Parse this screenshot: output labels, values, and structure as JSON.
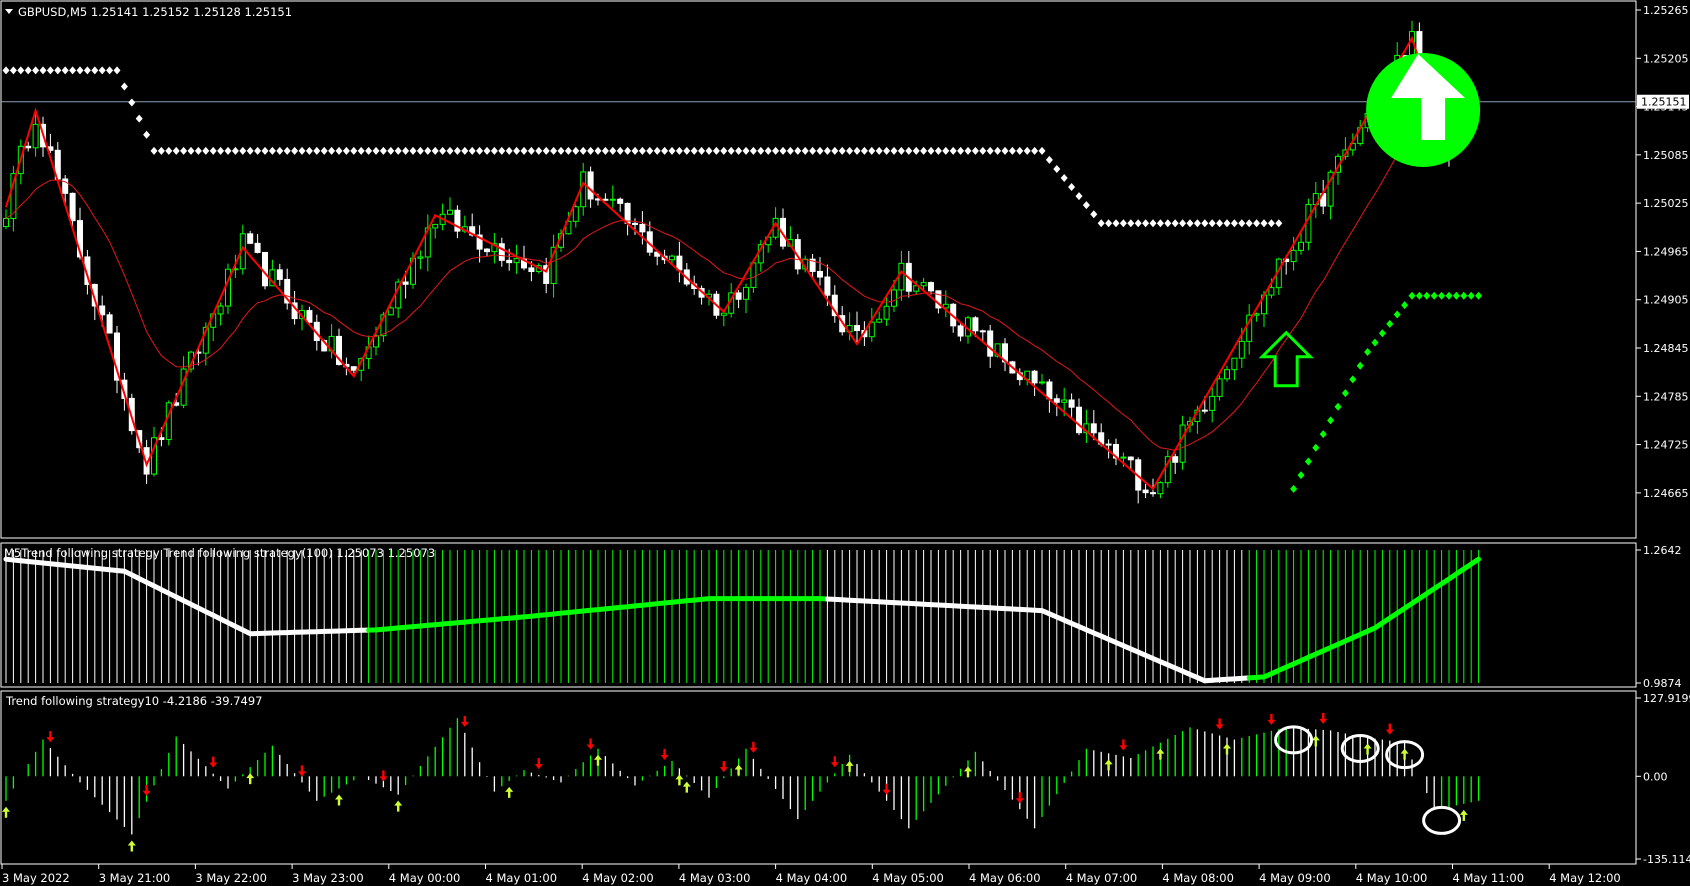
{
  "chart_data": [
    {
      "type": "line",
      "subtype": "candlestick",
      "title": "GBPUSD,M5  1.25141 1.25152 1.25128 1.25151",
      "symbol": "GBPUSD",
      "timeframe": "M5",
      "ohlc_header": {
        "open": 1.25141,
        "high": 1.25152,
        "low": 1.25128,
        "close": 1.25151
      },
      "ylim": [
        1.24635,
        1.25265
      ],
      "y_ticks": [
        "1.25265",
        "1.25205",
        "1.25145",
        "1.25085",
        "1.25025",
        "1.24965",
        "1.24905",
        "1.24845",
        "1.24785",
        "1.24725",
        "1.24665"
      ],
      "current_price_label": "1.25151",
      "current_price": 1.25151,
      "zigzag_pivots": [
        {
          "bar": 0,
          "price": 1.2502
        },
        {
          "bar": 4,
          "price": 1.2514
        },
        {
          "bar": 19,
          "price": 1.247
        },
        {
          "bar": 32,
          "price": 1.2497
        },
        {
          "bar": 47,
          "price": 1.2481
        },
        {
          "bar": 58,
          "price": 1.2501
        },
        {
          "bar": 73,
          "price": 1.2494
        },
        {
          "bar": 78,
          "price": 1.2505
        },
        {
          "bar": 97,
          "price": 1.2489
        },
        {
          "bar": 104,
          "price": 1.25
        },
        {
          "bar": 115,
          "price": 1.2485
        },
        {
          "bar": 121,
          "price": 1.2494
        },
        {
          "bar": 155,
          "price": 1.2467
        },
        {
          "bar": 190,
          "price": 1.2523
        },
        {
          "bar": 195,
          "price": 1.2509
        }
      ],
      "upper_dots": [
        {
          "bar": 0,
          "price": 1.2519
        },
        {
          "bar": 15,
          "price": 1.2519
        },
        {
          "bar": 20,
          "price": 1.2509
        },
        {
          "bar": 140,
          "price": 1.2509
        },
        {
          "bar": 148,
          "price": 1.25
        },
        {
          "bar": 172,
          "price": 1.25
        }
      ],
      "lower_dots": [
        {
          "bar": 174,
          "price": 1.2467
        },
        {
          "bar": 184,
          "price": 1.2484
        },
        {
          "bar": 190,
          "price": 1.2491
        },
        {
          "bar": 199,
          "price": 1.2491
        }
      ],
      "colors": {
        "up_candle": "#00ff00",
        "down_candle": "#ffffff",
        "zigzag": "#ff0000",
        "moving_average": "#e21818",
        "dots": "#ffffff",
        "lower_dots": "#00ff00",
        "signal_arrow": "#00ff00",
        "price_line": "#8a9fb5"
      }
    },
    {
      "type": "bar",
      "title": "M5Trend following strategy  Trend following strategy(100) 1.25073 1.25073",
      "ylim": [
        0.9874,
        1.2642
      ],
      "y_ticks": [
        "1.2642",
        "0.9874"
      ],
      "trend_line": [
        {
          "bar": 0,
          "value": 1.245
        },
        {
          "bar": 16,
          "value": 1.22
        },
        {
          "bar": 33,
          "value": 1.09
        },
        {
          "bar": 50,
          "value": 1.098
        },
        {
          "bar": 70,
          "value": 1.125
        },
        {
          "bar": 95,
          "value": 1.163
        },
        {
          "bar": 110,
          "value": 1.163
        },
        {
          "bar": 140,
          "value": 1.138
        },
        {
          "bar": 162,
          "value": 0.992
        },
        {
          "bar": 170,
          "value": 1.0
        },
        {
          "bar": 185,
          "value": 1.102
        },
        {
          "bar": 199,
          "value": 1.245
        }
      ],
      "green_segments": [
        [
          49,
          110
        ],
        [
          168,
          199
        ]
      ],
      "colors": {
        "bars_up": "#00ff00",
        "bars_down": "#ffffff",
        "line_up": "#00ff00",
        "line_down": "#ffffff"
      }
    },
    {
      "type": "bar",
      "title": "Trend following strategy10 -4.2186 -39.7497",
      "ylim": [
        -135.114,
        127.9199
      ],
      "y_ticks": [
        "127.9199",
        "0.00",
        "-135.114"
      ],
      "oscillator": [
        {
          "bar": 0,
          "value": -40
        },
        {
          "bar": 5,
          "value": 60
        },
        {
          "bar": 10,
          "value": -10
        },
        {
          "bar": 17,
          "value": -95
        },
        {
          "bar": 23,
          "value": 65
        },
        {
          "bar": 30,
          "value": -20
        },
        {
          "bar": 36,
          "value": 50
        },
        {
          "bar": 42,
          "value": -40
        },
        {
          "bar": 48,
          "value": 0
        },
        {
          "bar": 53,
          "value": -30
        },
        {
          "bar": 61,
          "value": 95
        },
        {
          "bar": 66,
          "value": -25
        },
        {
          "bar": 70,
          "value": 10
        },
        {
          "bar": 75,
          "value": -10
        },
        {
          "bar": 80,
          "value": 45
        },
        {
          "bar": 85,
          "value": -15
        },
        {
          "bar": 90,
          "value": 25
        },
        {
          "bar": 95,
          "value": -35
        },
        {
          "bar": 100,
          "value": 45
        },
        {
          "bar": 107,
          "value": -70
        },
        {
          "bar": 114,
          "value": 35
        },
        {
          "bar": 122,
          "value": -85
        },
        {
          "bar": 131,
          "value": 40
        },
        {
          "bar": 139,
          "value": -85
        },
        {
          "bar": 146,
          "value": 45
        },
        {
          "bar": 152,
          "value": 30
        },
        {
          "bar": 160,
          "value": 80
        },
        {
          "bar": 166,
          "value": 60
        },
        {
          "bar": 173,
          "value": 80
        },
        {
          "bar": 179,
          "value": 75
        },
        {
          "bar": 183,
          "value": 65
        },
        {
          "bar": 189,
          "value": 55
        },
        {
          "bar": 193,
          "value": -55
        },
        {
          "bar": 199,
          "value": -40
        }
      ],
      "down_arrow_bars": [
        6,
        19,
        28,
        40,
        51,
        62,
        72,
        79,
        89,
        97,
        101,
        112,
        119,
        137,
        151,
        164,
        171,
        178,
        187
      ],
      "up_arrow_bars": [
        0,
        17,
        33,
        45,
        53,
        68,
        80,
        91,
        92,
        99,
        114,
        130,
        149,
        156,
        165,
        177,
        184,
        189,
        197
      ],
      "circled_up_arrow_bars": [
        174,
        183,
        189,
        194
      ],
      "colors": {
        "bars_up": "#00ff00",
        "bars_down": "#ffffff",
        "down_arrow": "#ff0000",
        "up_arrow": "#ccff33",
        "circle": "#ffffff"
      }
    }
  ],
  "x_axis_labels": [
    "3 May 2022",
    "3 May 21:00",
    "3 May 22:00",
    "3 May 23:00",
    "4 May 00:00",
    "4 May 01:00",
    "4 May 02:00",
    "4 May 03:00",
    "4 May 04:00",
    "4 May 05:00",
    "4 May 06:00",
    "4 May 07:00",
    "4 May 08:00",
    "4 May 09:00",
    "4 May 10:00",
    "4 May 11:00",
    "4 May 12:00"
  ]
}
